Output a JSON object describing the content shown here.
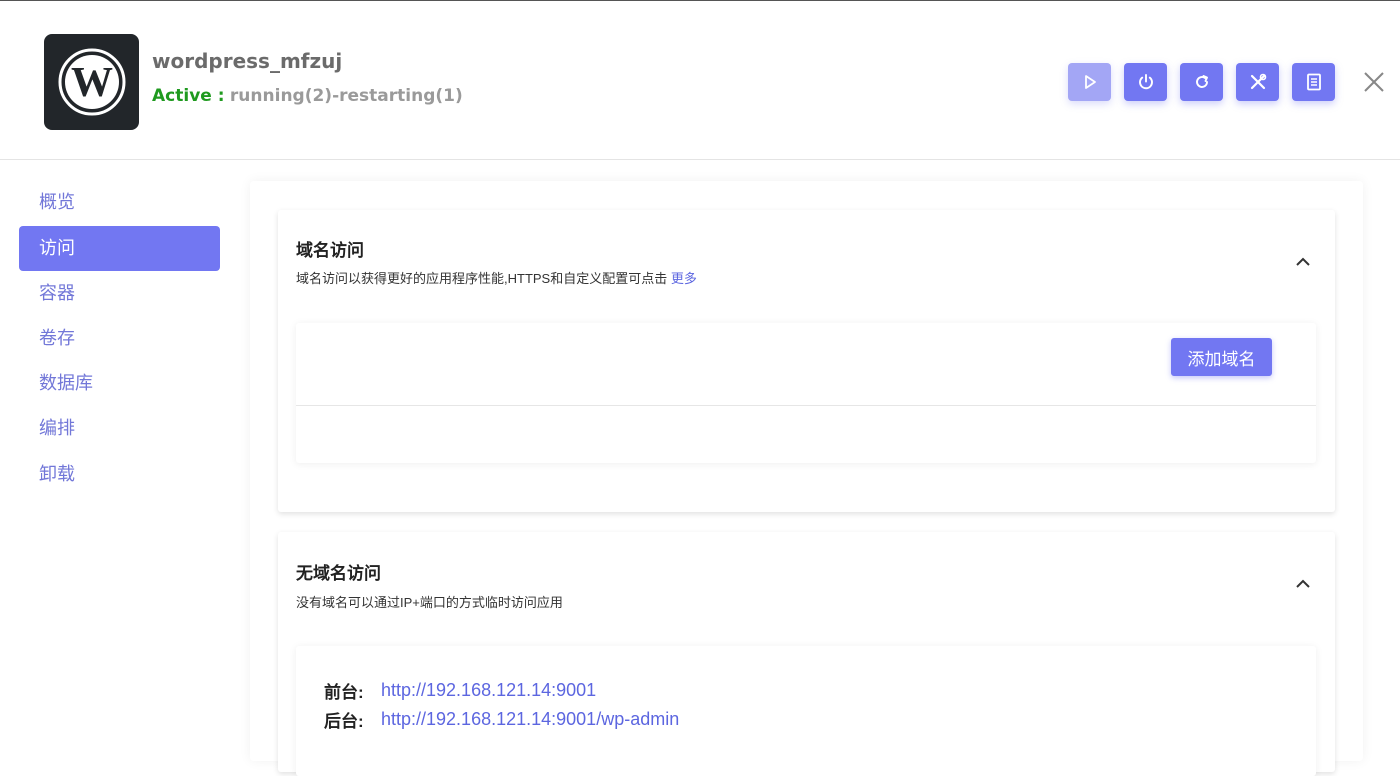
{
  "app": {
    "name": "wordpress_mfzuj",
    "status_label": "Active :",
    "status_value": "running(2)-restarting(1)",
    "logo_icon": "wordpress-logo-icon"
  },
  "actions": [
    {
      "name": "start",
      "icon": "play-icon"
    },
    {
      "name": "stop",
      "icon": "power-icon"
    },
    {
      "name": "restart",
      "icon": "refresh-icon"
    },
    {
      "name": "settings",
      "icon": "tools-icon"
    },
    {
      "name": "logs",
      "icon": "document-icon"
    }
  ],
  "sidebar": {
    "items": [
      {
        "label": "概览"
      },
      {
        "label": "访问",
        "active": true
      },
      {
        "label": "容器"
      },
      {
        "label": "卷存"
      },
      {
        "label": "数据库"
      },
      {
        "label": "编排"
      },
      {
        "label": "卸载"
      }
    ]
  },
  "domain_access": {
    "title": "域名访问",
    "description": "域名访问以获得更好的应用程序性能,HTTPS和自定义配置可点击",
    "more_link": "更多",
    "add_button": "添加域名"
  },
  "no_domain_access": {
    "title": "无域名访问",
    "description": "没有域名可以通过IP+端口的方式临时访问应用",
    "frontend_label": "前台:",
    "frontend_url": "http://192.168.121.14:9001",
    "backend_label": "后台:",
    "backend_url": "http://192.168.121.14:9001/wp-admin"
  },
  "colors": {
    "accent": "#7277f2",
    "active_status": "#1f9a1f",
    "link": "#5c66e0"
  }
}
